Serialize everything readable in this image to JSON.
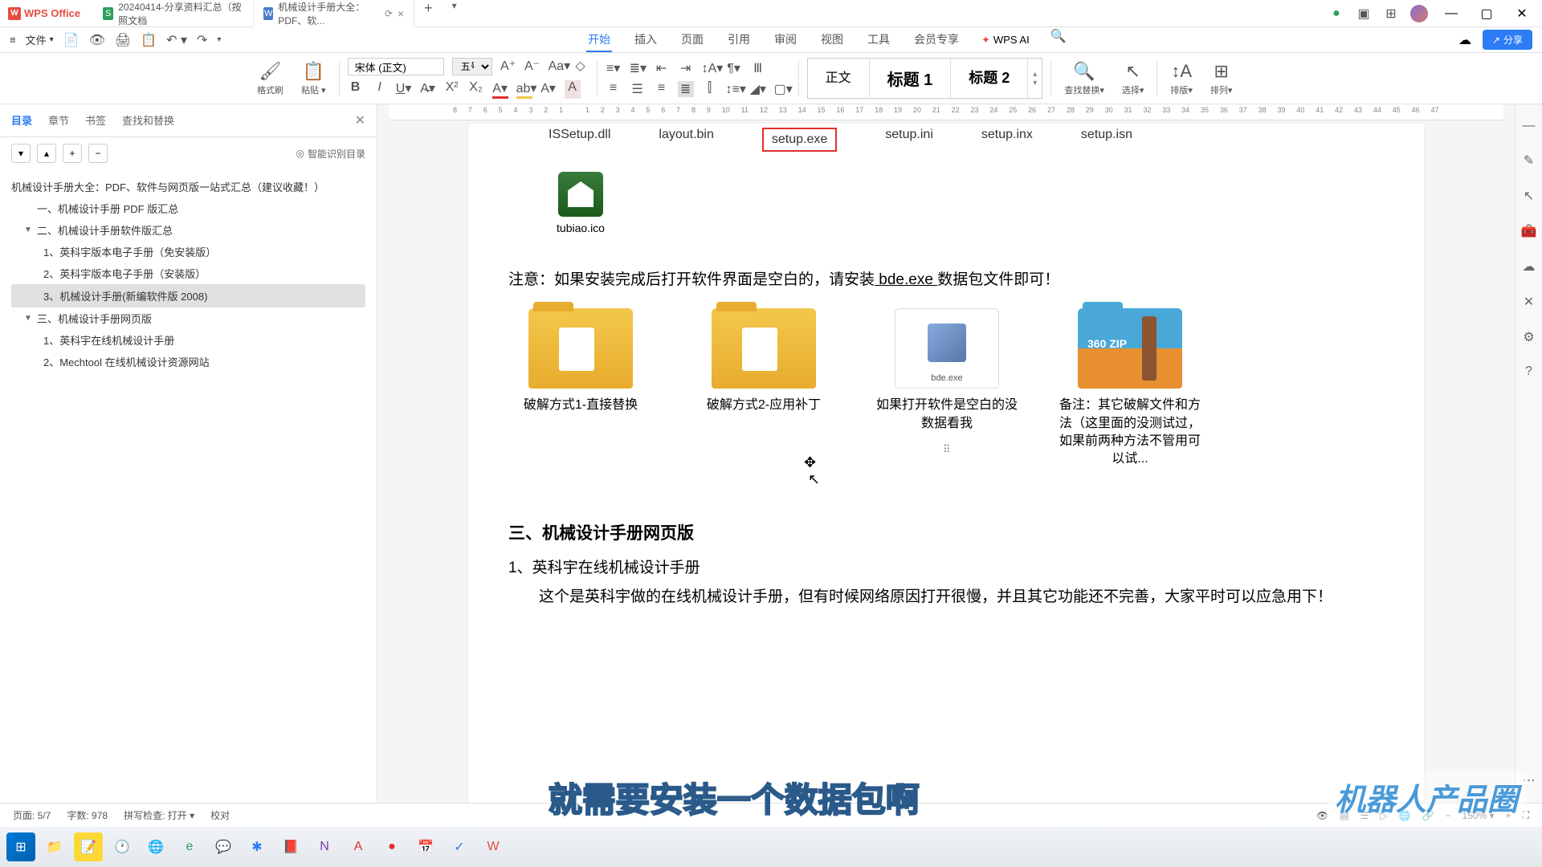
{
  "app": {
    "name": "WPS Office"
  },
  "tabs": [
    {
      "label": "20240414-分享资料汇总（按照文档",
      "icon": "S",
      "iconClass": "doc-icon-green"
    },
    {
      "label": "机械设计手册大全：PDF、软...",
      "icon": "W",
      "iconClass": "doc-icon-blue"
    }
  ],
  "file_menu": "文件",
  "menubar": [
    "开始",
    "插入",
    "页面",
    "引用",
    "审阅",
    "视图",
    "工具",
    "会员专享"
  ],
  "ai_label": "WPS AI",
  "share": "分享",
  "toolbar": {
    "format_painter": "格式刷",
    "paste": "粘贴",
    "font": "宋体 (正文)",
    "size": "五号",
    "styles": {
      "body": "正文",
      "h1": "标题 1",
      "h2": "标题 2"
    },
    "find": "查找替换",
    "select": "选择",
    "layout": "排版",
    "sort": "排列"
  },
  "sidebar": {
    "tabs": [
      "目录",
      "章节",
      "书签",
      "查找和替换"
    ],
    "ai_outline": "智能识别目录",
    "items": [
      {
        "label": "机械设计手册大全：PDF、软件与网页版一站式汇总（建议收藏！）",
        "level": 0
      },
      {
        "label": "一、机械设计手册 PDF 版汇总",
        "level": 1
      },
      {
        "label": "二、机械设计手册软件版汇总",
        "level": 1,
        "arrow": "▼"
      },
      {
        "label": "1、英科宇版本电子手册（免安装版）",
        "level": 2
      },
      {
        "label": "2、英科宇版本电子手册（安装版）",
        "level": 2
      },
      {
        "label": "3、机械设计手册(新编软件版 2008)",
        "level": 2,
        "selected": true
      },
      {
        "label": "三、机械设计手册网页版",
        "level": 1,
        "arrow": "▼"
      },
      {
        "label": "1、英科宇在线机械设计手册",
        "level": 2
      },
      {
        "label": "2、Mechtool 在线机械设计资源网站",
        "level": 2
      }
    ]
  },
  "doc": {
    "files_row": [
      "ISSetup.dll",
      "layout.bin",
      "setup.exe",
      "setup.ini",
      "setup.inx",
      "setup.isn"
    ],
    "tubiao": "tubiao.ico",
    "note_pre": "注意：如果安装完成后打开软件界面是空白的，请安装",
    "note_u": " bde.exe ",
    "note_post": "数据包文件即可！",
    "zip360": "360 ZIP",
    "exe_name": "bde.exe",
    "folders": [
      "破解方式1-直接替换",
      "破解方式2-应用补丁",
      "如果打开软件是空白的没数据看我",
      "备注：其它破解文件和方法（这里面的没测试过，如果前两种方法不管用可以试..."
    ],
    "h3": "三、机械设计手册网页版",
    "p1": "1、英科宇在线机械设计手册",
    "p2": "这个是英科宇做的在线机械设计手册，但有时候网络原因打开很慢，并且其它功能还不完善，大家平时可以应急用下！"
  },
  "status": {
    "page": "页面: 5/7",
    "words": "字数: 978",
    "spell": "拼写检查: 打开",
    "proof": "校对",
    "zoom": "150%"
  },
  "ruler": [
    "8",
    "7",
    "6",
    "5",
    "4",
    "3",
    "2",
    "1",
    "",
    "1",
    "2",
    "3",
    "4",
    "5",
    "6",
    "7",
    "8",
    "9",
    "10",
    "11",
    "12",
    "13",
    "14",
    "15",
    "16",
    "17",
    "18",
    "19",
    "20",
    "21",
    "22",
    "23",
    "24",
    "25",
    "26",
    "27",
    "28",
    "29",
    "30",
    "31",
    "32",
    "33",
    "34",
    "35",
    "36",
    "37",
    "38",
    "39",
    "40",
    "41",
    "42",
    "43",
    "44",
    "45",
    "46",
    "47"
  ],
  "subtitles": {
    "main": "就需要安装一个数据包啊",
    "brand": "机器人产品圈"
  }
}
